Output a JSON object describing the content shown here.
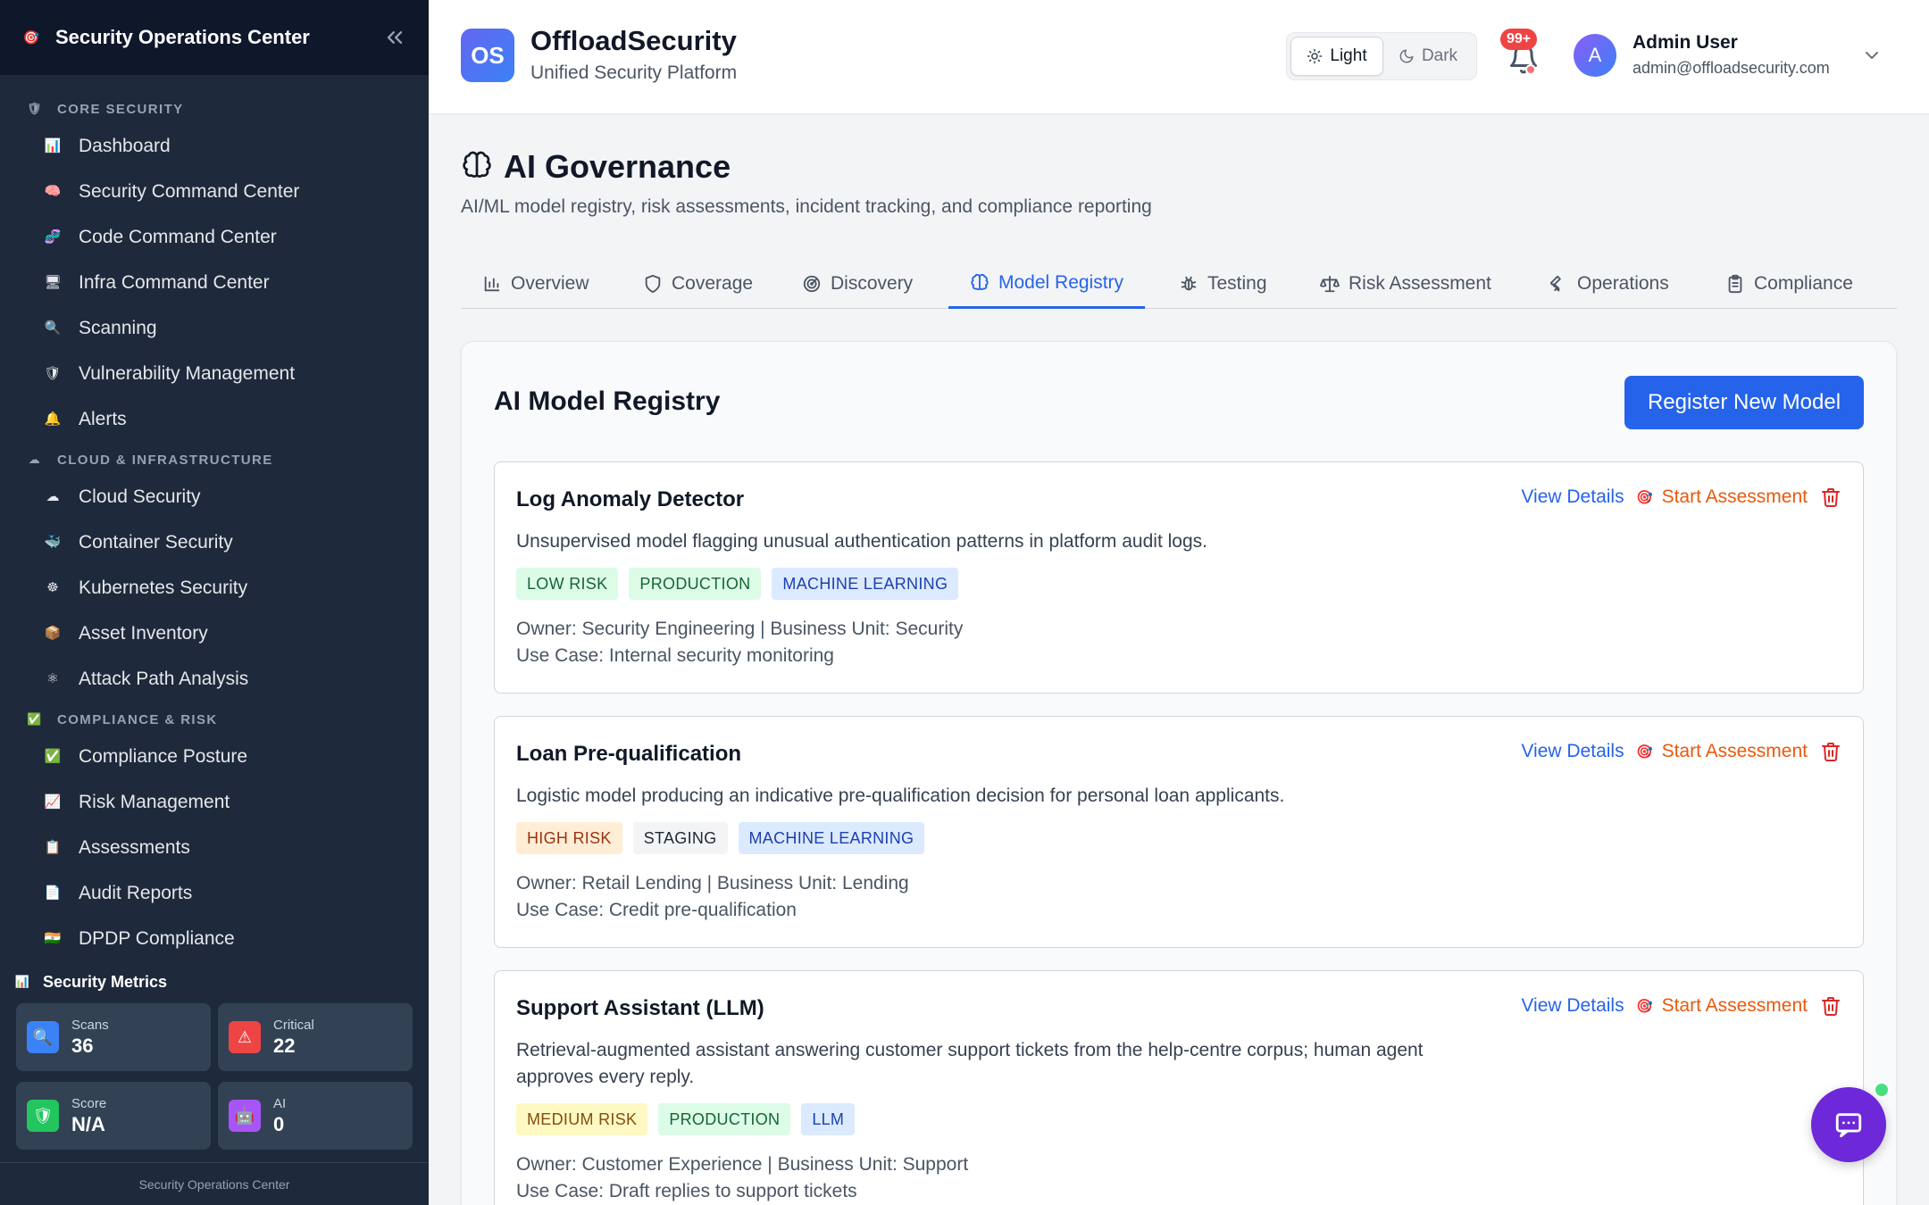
{
  "sidebar": {
    "title": "Security Operations Center",
    "sections": [
      {
        "header": "CORE SECURITY",
        "icon": "shield-icon",
        "items": [
          {
            "label": "Dashboard",
            "icon": "bar-chart-icon"
          },
          {
            "label": "Security Command Center",
            "icon": "brain-icon"
          },
          {
            "label": "Code Command Center",
            "icon": "dna-icon"
          },
          {
            "label": "Infra Command Center",
            "icon": "monitor-icon"
          },
          {
            "label": "Scanning",
            "icon": "magnifier-icon"
          },
          {
            "label": "Vulnerability Management",
            "icon": "shield-icon"
          },
          {
            "label": "Alerts",
            "icon": "bell-icon"
          }
        ]
      },
      {
        "header": "CLOUD & INFRASTRUCTURE",
        "icon": "cloud-icon",
        "items": [
          {
            "label": "Cloud Security",
            "icon": "cloud-icon"
          },
          {
            "label": "Container Security",
            "icon": "whale-icon"
          },
          {
            "label": "Kubernetes Security",
            "icon": "helm-icon"
          },
          {
            "label": "Asset Inventory",
            "icon": "package-icon"
          },
          {
            "label": "Attack Path Analysis",
            "icon": "atom-icon"
          }
        ]
      },
      {
        "header": "COMPLIANCE & RISK",
        "icon": "check-icon",
        "items": [
          {
            "label": "Compliance Posture",
            "icon": "check-icon"
          },
          {
            "label": "Risk Management",
            "icon": "chart-up-icon"
          },
          {
            "label": "Assessments",
            "icon": "clipboard-icon"
          },
          {
            "label": "Audit Reports",
            "icon": "document-icon"
          },
          {
            "label": "DPDP Compliance",
            "icon": "flag-india-icon"
          }
        ]
      }
    ],
    "metrics": {
      "title": "Security Metrics",
      "cards": [
        {
          "label": "Scans",
          "value": "36",
          "icon": "magnifier-icon"
        },
        {
          "label": "Critical",
          "value": "22",
          "icon": "warning-icon"
        },
        {
          "label": "Score",
          "value": "N/A",
          "icon": "shield-icon"
        },
        {
          "label": "AI",
          "value": "0",
          "icon": "robot-icon"
        }
      ]
    },
    "footer": "Security Operations Center"
  },
  "header": {
    "logo": "OS",
    "brand_name": "OffloadSecurity",
    "brand_tagline": "Unified Security Platform",
    "theme_light": "Light",
    "theme_dark": "Dark",
    "notifications_badge": "99+",
    "avatar_letter": "A",
    "user_name": "Admin User",
    "user_email": "admin@offloadsecurity.com"
  },
  "page": {
    "title": "AI Governance",
    "subtitle": "AI/ML model registry, risk assessments, incident tracking, and compliance reporting",
    "tabs": [
      {
        "label": "Overview",
        "icon": "bar-chart-icon"
      },
      {
        "label": "Coverage",
        "icon": "shield-icon"
      },
      {
        "label": "Discovery",
        "icon": "radar-icon"
      },
      {
        "label": "Model Registry",
        "icon": "brain-icon",
        "active": true
      },
      {
        "label": "Testing",
        "icon": "bug-icon"
      },
      {
        "label": "Risk Assessment",
        "icon": "scale-icon"
      },
      {
        "label": "Operations",
        "icon": "wrench-icon"
      },
      {
        "label": "Compliance",
        "icon": "clipboard-icon"
      }
    ]
  },
  "registry": {
    "title": "AI Model Registry",
    "register_button": "Register New Model",
    "view_label": "View Details",
    "start_label": "Start Assessment",
    "models": [
      {
        "name": "Log Anomaly Detector",
        "description": "Unsupervised model flagging unusual authentication patterns in platform audit logs.",
        "tags": [
          {
            "text": "LOW RISK",
            "kind": "low"
          },
          {
            "text": "PRODUCTION",
            "kind": "prod"
          },
          {
            "text": "MACHINE LEARNING",
            "kind": "ml"
          }
        ],
        "owner_line": "Owner: Security Engineering | Business Unit: Security",
        "use_case": "Use Case: Internal security monitoring"
      },
      {
        "name": "Loan Pre-qualification",
        "description": "Logistic model producing an indicative pre-qualification decision for personal loan applicants.",
        "tags": [
          {
            "text": "HIGH RISK",
            "kind": "high"
          },
          {
            "text": "STAGING",
            "kind": "stag"
          },
          {
            "text": "MACHINE LEARNING",
            "kind": "ml"
          }
        ],
        "owner_line": "Owner: Retail Lending | Business Unit: Lending",
        "use_case": "Use Case: Credit pre-qualification"
      },
      {
        "name": "Support Assistant (LLM)",
        "description": "Retrieval-augmented assistant answering customer support tickets from the help-centre corpus; human agent approves every reply.",
        "tags": [
          {
            "text": "MEDIUM RISK",
            "kind": "med"
          },
          {
            "text": "PRODUCTION",
            "kind": "prod"
          },
          {
            "text": "LLM",
            "kind": "ml"
          }
        ],
        "owner_line": "Owner: Customer Experience | Business Unit: Support",
        "use_case": "Use Case: Draft replies to support tickets"
      }
    ]
  },
  "colors": {
    "accent": "#2563eb",
    "sidebar_bg": "#1e293b",
    "start_assessment": "#ea580c",
    "delete": "#dc2626"
  }
}
